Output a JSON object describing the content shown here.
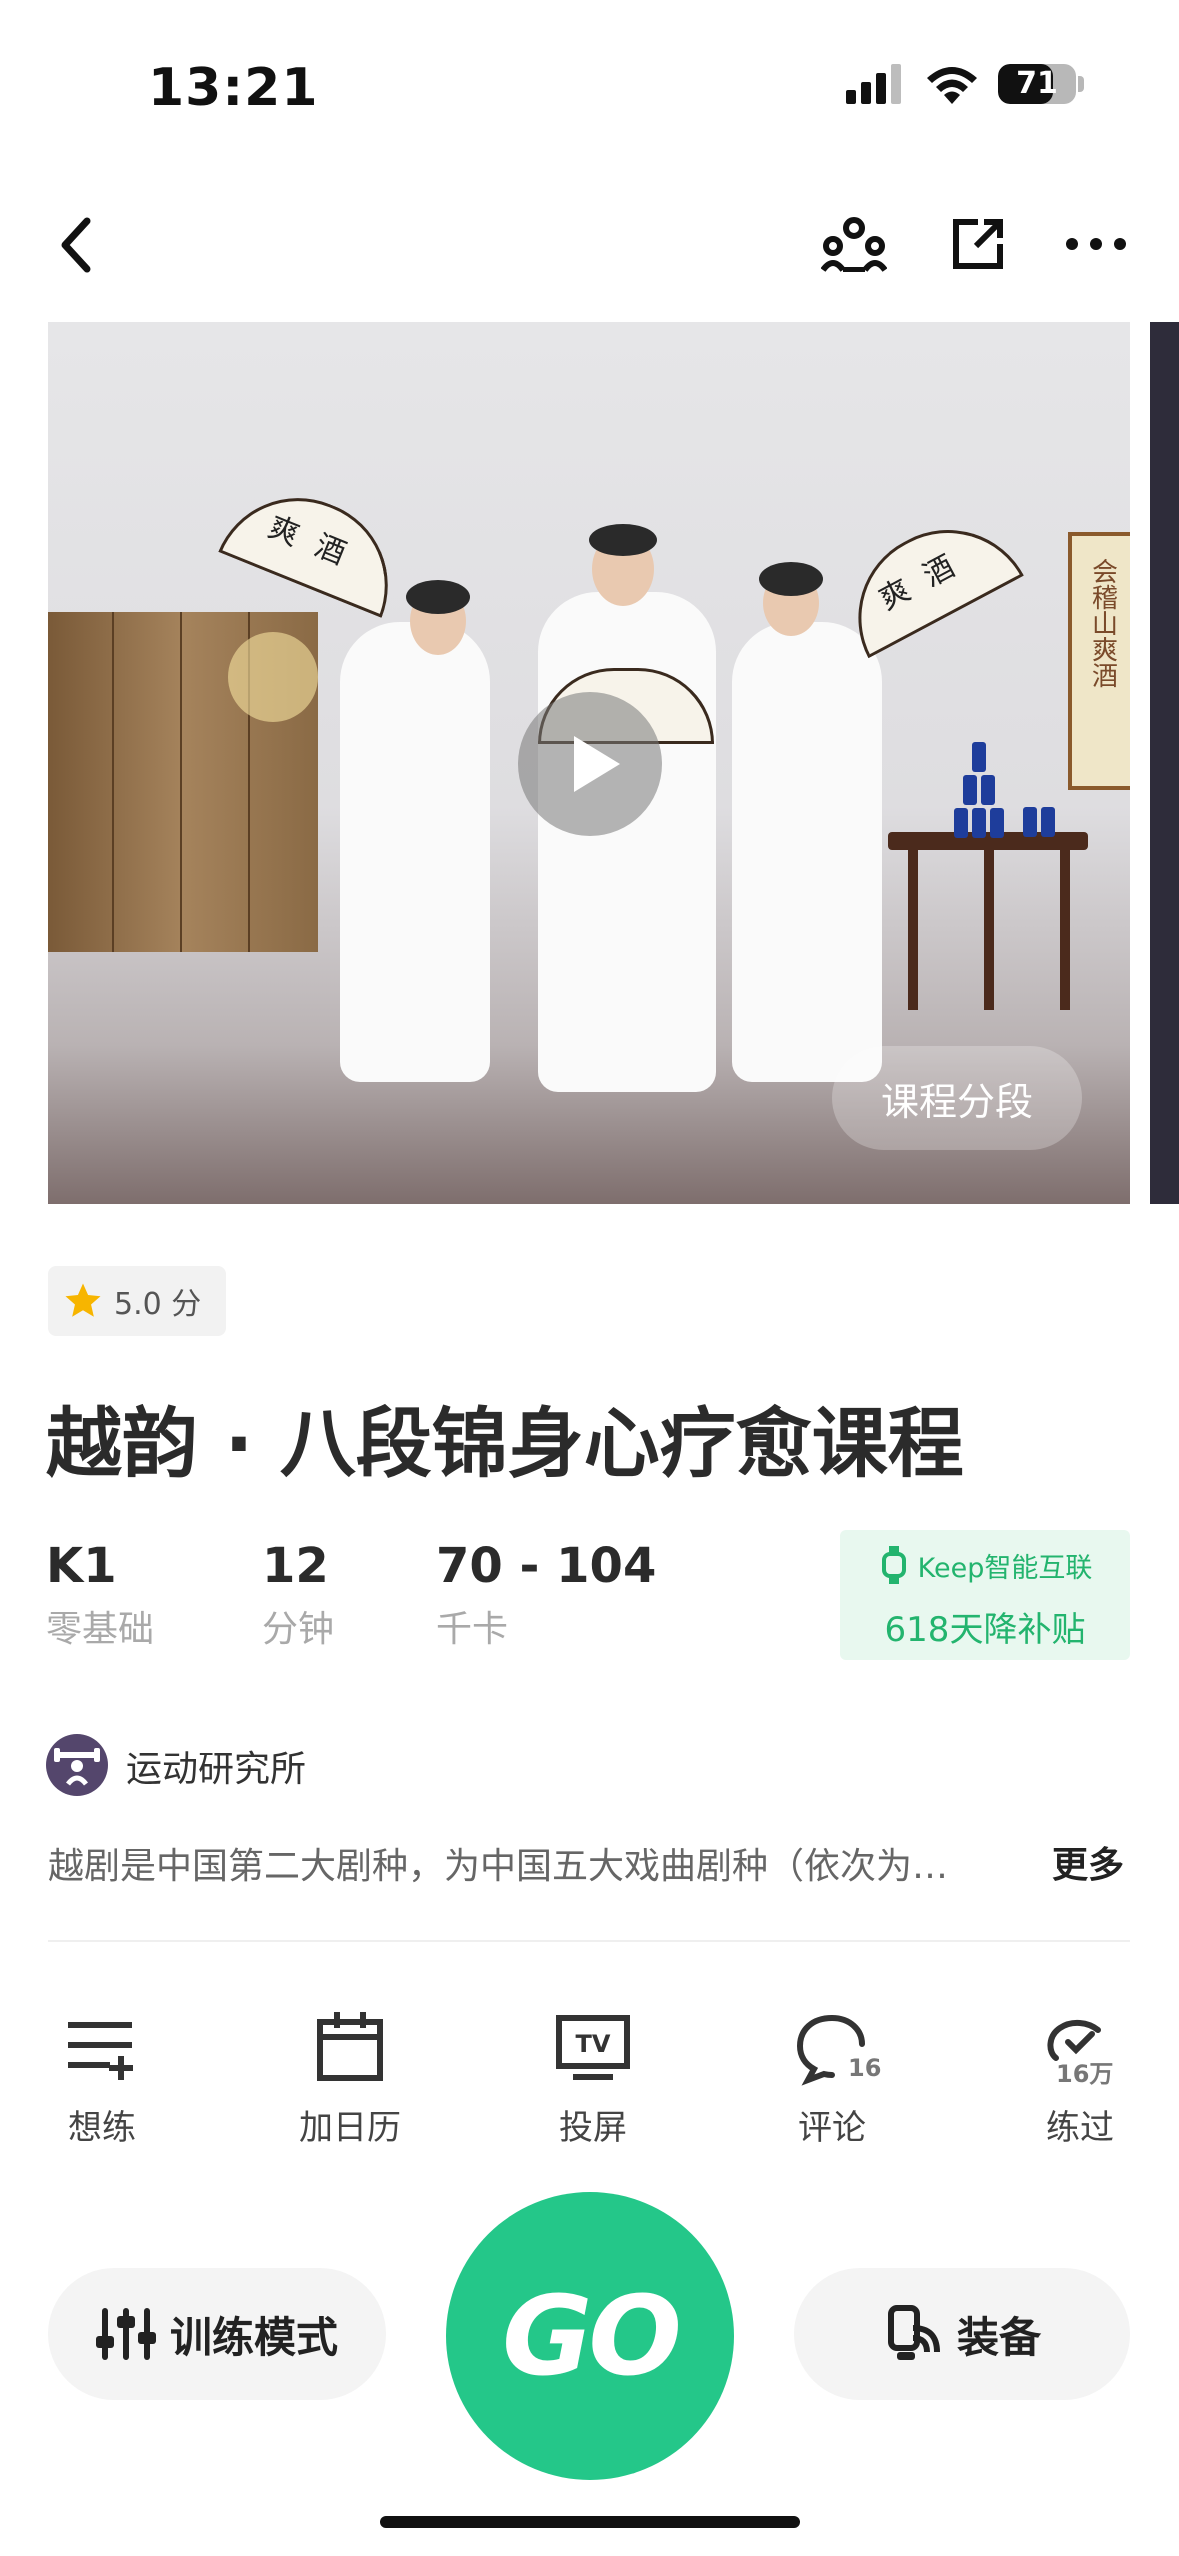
{
  "status_bar": {
    "time": "13:21",
    "battery": "71",
    "battery_level": 0.71
  },
  "nav": {
    "back": "chevron-left-icon",
    "group": "group-icon",
    "share": "share-icon",
    "more": "more-icon"
  },
  "video": {
    "segments_label": "课程分段",
    "artwork_text": "会稽山爽酒",
    "fan_text": "爽酒"
  },
  "course": {
    "rating": "5.0 分",
    "title": "越韵 · 八段锦身心疗愈课程",
    "stats": [
      {
        "value": "K1",
        "label": "零基础"
      },
      {
        "value": "12",
        "label": "分钟"
      },
      {
        "value": "70 - 104",
        "label": "千卡"
      }
    ],
    "promo": {
      "line1": "Keep智能互联",
      "line2": "618天降补贴"
    },
    "author": "运动研究所",
    "description": "越剧是中国第二大剧种，为中国五大戏曲剧种（依次为…",
    "more_label": "更多"
  },
  "actions": [
    {
      "label": "想练",
      "icon": "add-to-list-icon",
      "badge": ""
    },
    {
      "label": "加日历",
      "icon": "calendar-icon",
      "badge": ""
    },
    {
      "label": "投屏",
      "icon": "tv-cast-icon",
      "badge": ""
    },
    {
      "label": "评论",
      "icon": "comment-icon",
      "badge": "16"
    },
    {
      "label": "练过",
      "icon": "trained-icon",
      "badge": "16万"
    }
  ],
  "bottom": {
    "mode_label": "训练模式",
    "go_label": "GO",
    "equip_label": "装备"
  },
  "colors": {
    "accent": "#24c789",
    "promo_text": "#23b46e",
    "promo_bg": "#e8f8ef"
  }
}
